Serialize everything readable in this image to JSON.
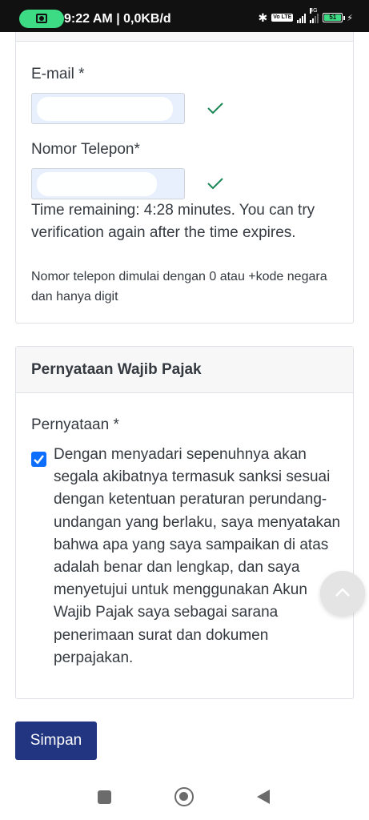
{
  "status_bar": {
    "time_and_speed": "9:22 AM | 0,0KB/d",
    "network_label": "4G",
    "volte_label": "Vo LTE",
    "battery_level": "51"
  },
  "contact": {
    "email_label": "E-mail *",
    "email_value": "",
    "phone_label": "Nomor Telepon*",
    "phone_value": "",
    "time_remaining": "Time remaining: 4:28 minutes. You can try verification again after the time expires.",
    "help_text": "Nomor telepon dimulai dengan 0 atau +kode negara dan hanya digit"
  },
  "statement": {
    "header": "Pernyataan Wajib Pajak",
    "label": "Pernyataan *",
    "checked": true,
    "text": "Dengan menyadari sepenuhnya akan segala akibatnya termasuk sanksi sesuai dengan ketentuan peraturan perundang-undangan yang berlaku, saya menyatakan bahwa apa yang saya sampaikan di atas adalah benar dan lengkap, dan saya menyetujui untuk menggunakan Akun Wajib Pajak saya sebagai sarana penerimaan surat dan dokumen perpajakan."
  },
  "actions": {
    "save_label": "Simpan"
  },
  "colors": {
    "primary_button": "#213580",
    "checkbox": "#0d6efd",
    "valid_check": "#198754",
    "autofill_bg": "#e8f0fe"
  },
  "icons": [
    "camera-icon",
    "bluetooth-icon",
    "signal-icon",
    "battery-icon",
    "check-icon",
    "chevron-up-icon",
    "recents-icon",
    "home-icon",
    "back-icon"
  ]
}
